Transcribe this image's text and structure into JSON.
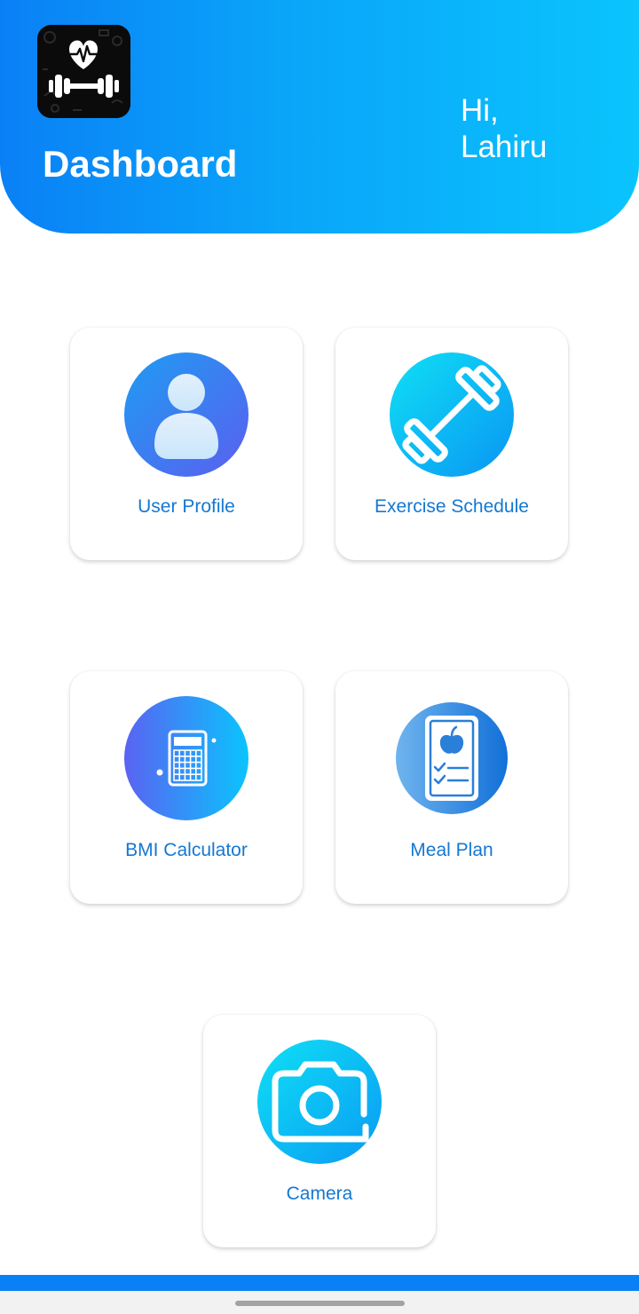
{
  "header": {
    "title": "Dashboard",
    "greeting_line1": "Hi,",
    "greeting_line2": "Lahiru",
    "logo_icon": "heart-dumbbell-logo-icon"
  },
  "cards": [
    {
      "label": "User Profile",
      "icon": "user-icon"
    },
    {
      "label": "Exercise Schedule",
      "icon": "dumbbell-icon"
    },
    {
      "label": "BMI Calculator",
      "icon": "calculator-icon"
    },
    {
      "label": "Meal Plan",
      "icon": "meal-plan-icon"
    },
    {
      "label": "Camera",
      "icon": "camera-icon"
    }
  ],
  "colors": {
    "header_gradient_start": "#0a80f6",
    "header_gradient_end": "#0ac4fd",
    "card_label": "#1478d2",
    "bottom_stripe": "#0a80f6"
  }
}
